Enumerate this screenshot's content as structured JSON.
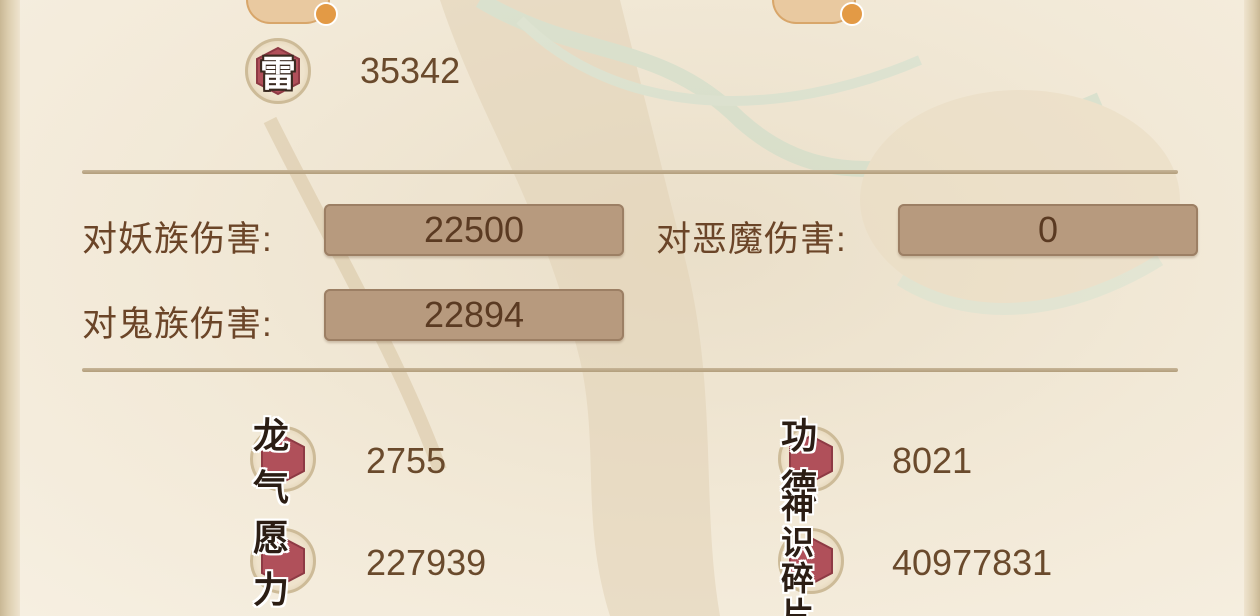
{
  "thunder": {
    "icon_label": "雷",
    "value": "35342"
  },
  "damage": {
    "yao_label": "对妖族伤害:",
    "yao_value": "22500",
    "demon_label": "对恶魔伤害:",
    "demon_value": "0",
    "ghost_label": "对鬼族伤害:",
    "ghost_value": "22894"
  },
  "stats": {
    "longqi_label": "龙气",
    "longqi_value": "2755",
    "gongde_label": "功德",
    "gongde_value": "8021",
    "yuanli_label": "愿力",
    "yuanli_value": "227939",
    "shenshi_label_line1": "神识",
    "shenshi_label_line2": "碎片",
    "shenshi_value": "40977831"
  },
  "colors": {
    "gem": "#b0505a",
    "box": "#b79a7e",
    "text": "#6b4528"
  },
  "icons": [
    "hexagon-gem-icon",
    "alert-badge-icon",
    "shield-badge-icon"
  ]
}
